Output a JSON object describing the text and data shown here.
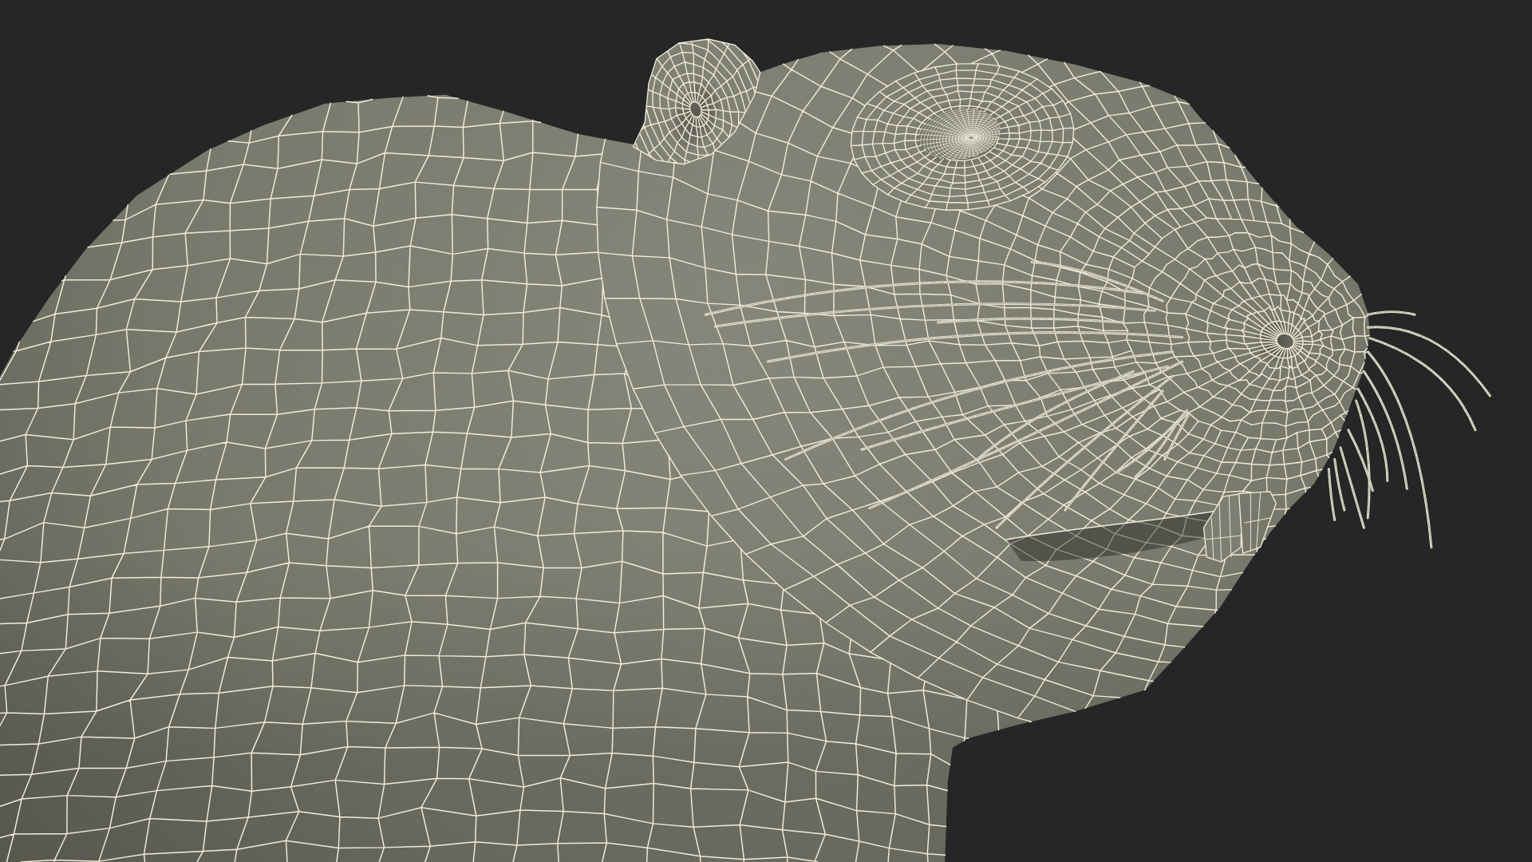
{
  "viewport": {
    "kind": "wireframe"
  }
}
